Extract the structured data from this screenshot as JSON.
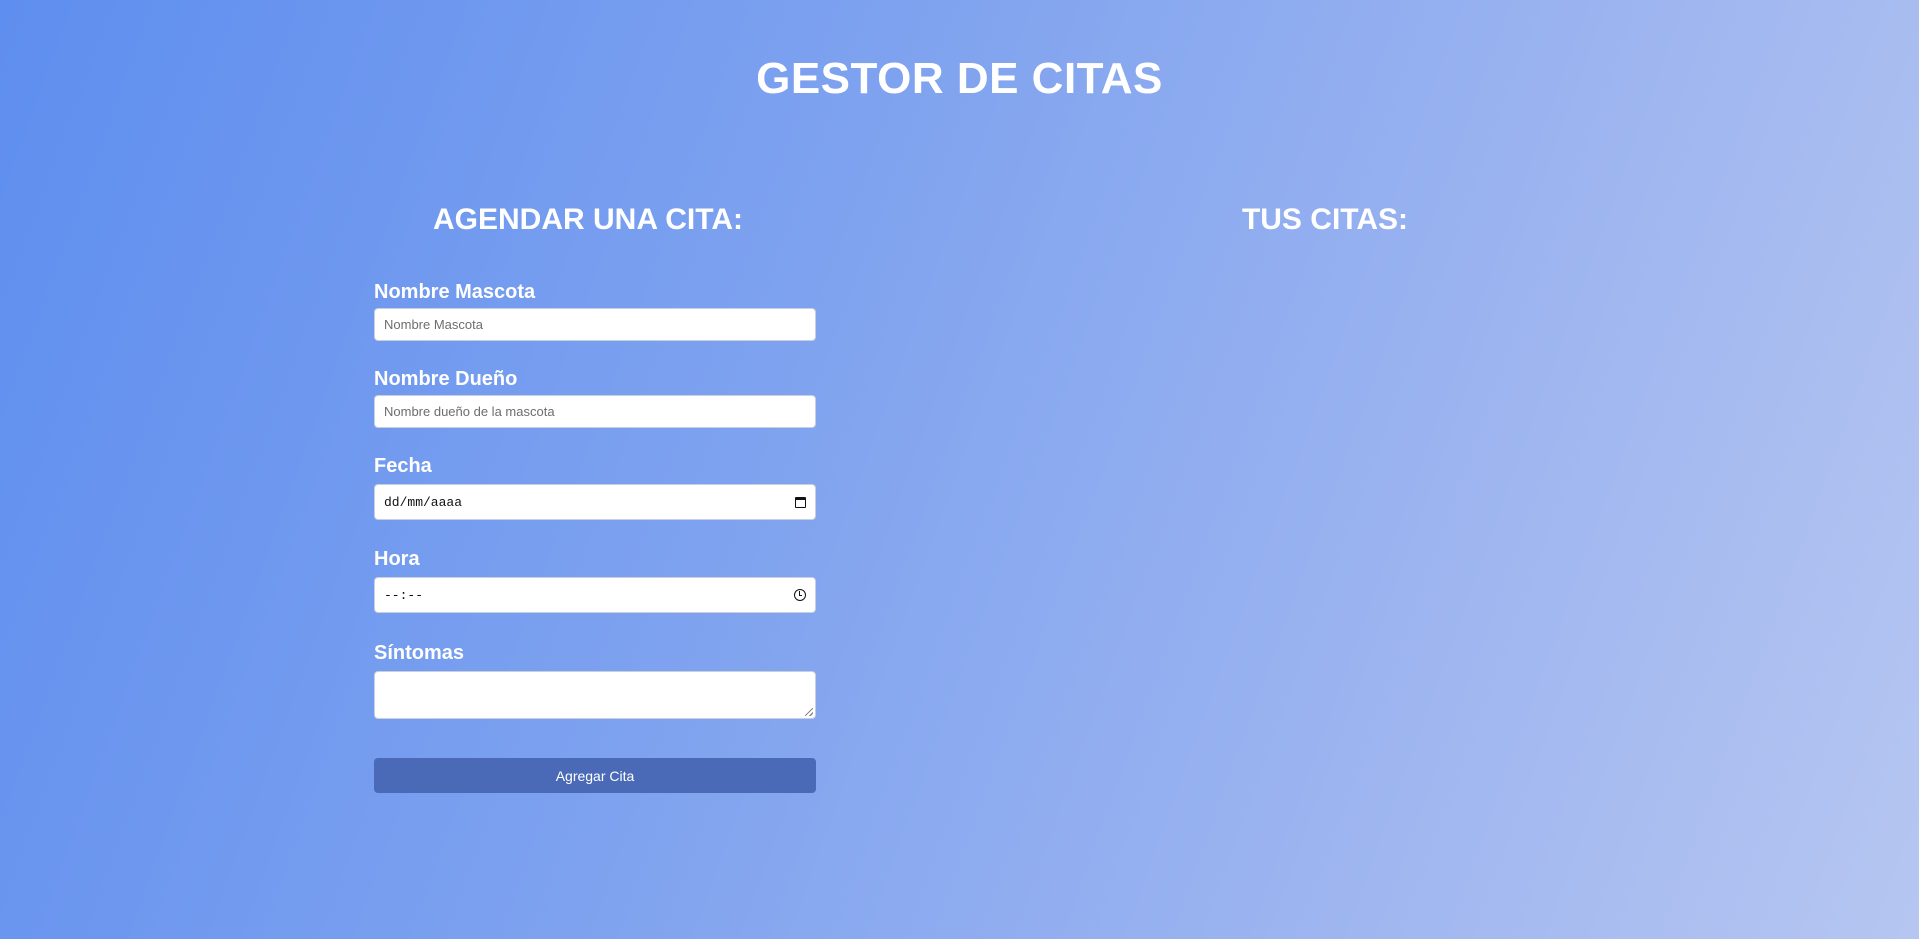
{
  "header": {
    "title": "GESTOR DE CITAS"
  },
  "form_section": {
    "title": "AGENDAR UNA CITA:",
    "fields": {
      "pet_name": {
        "label": "Nombre Mascota",
        "placeholder": "Nombre Mascota"
      },
      "owner_name": {
        "label": "Nombre Dueño",
        "placeholder": "Nombre dueño de la mascota"
      },
      "date": {
        "label": "Fecha",
        "placeholder": "dd/mm/aaaa",
        "icon": "calendar-icon"
      },
      "time": {
        "label": "Hora",
        "placeholder": "--:--",
        "icon": "clock-icon"
      },
      "symptoms": {
        "label": "Síntomas",
        "value": ""
      }
    },
    "submit_label": "Agregar Cita",
    "submit_color": "#4a6ab7"
  },
  "appointments_section": {
    "title": "TUS CITAS:",
    "items": []
  },
  "colors": {
    "background_start": "#5e8eef",
    "background_end": "#b6c6f1",
    "text": "#ffffff"
  }
}
